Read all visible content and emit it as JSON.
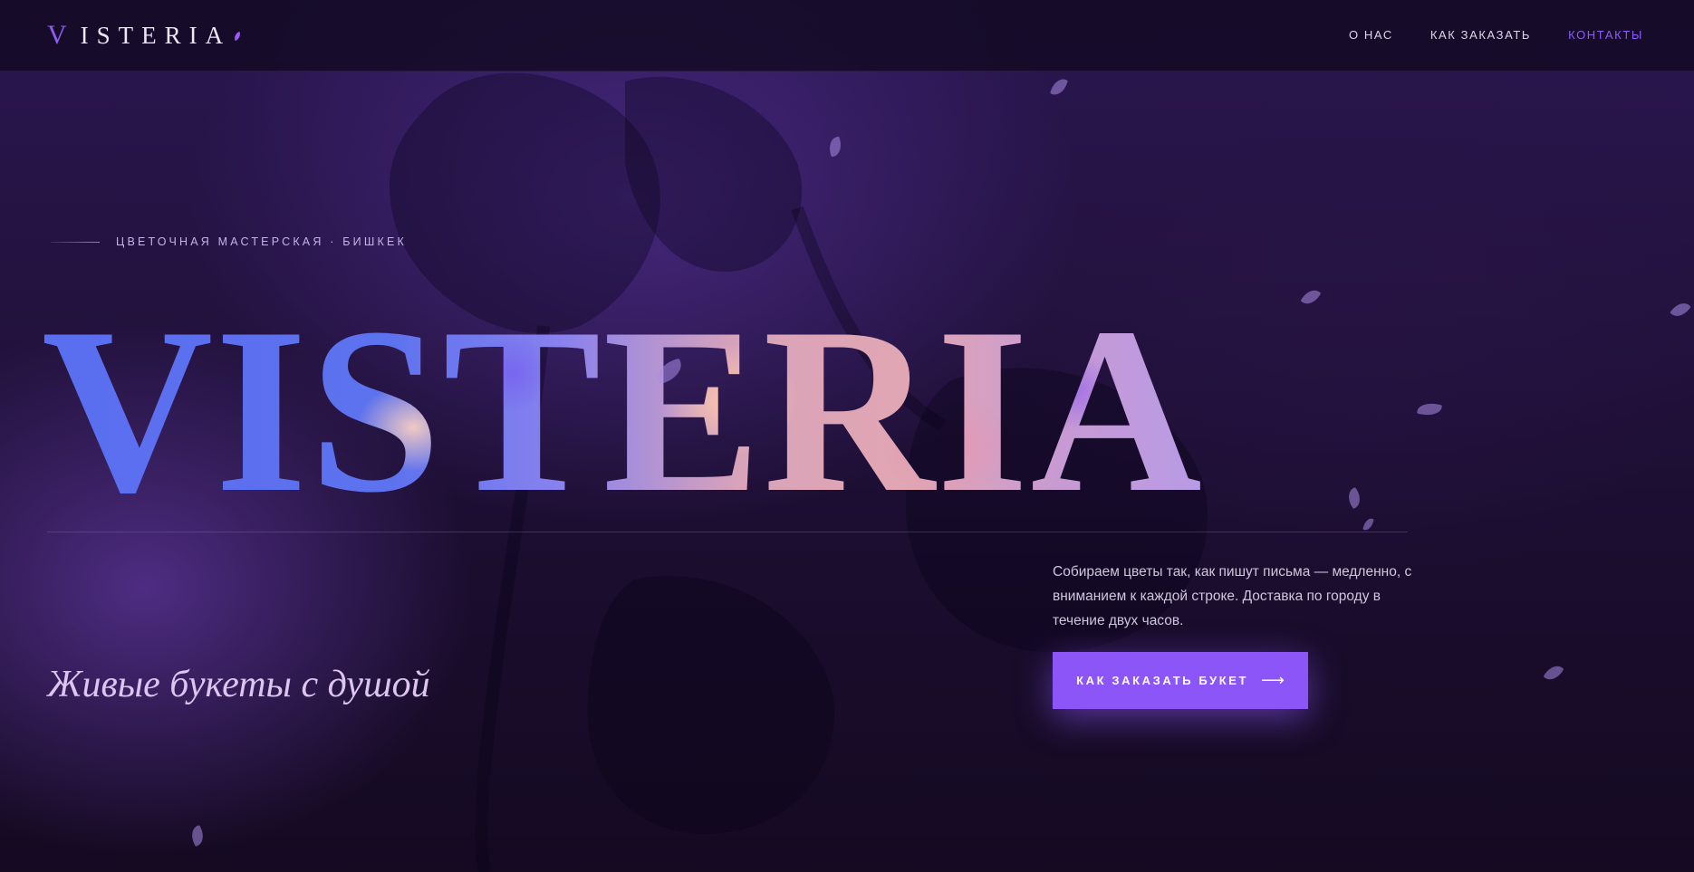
{
  "header": {
    "logo": {
      "initial": "V",
      "rest": "ISTERIA"
    },
    "nav": [
      {
        "label": "О НАС",
        "active": false
      },
      {
        "label": "КАК ЗАКАЗАТЬ",
        "active": false
      },
      {
        "label": "КОНТАКТЫ",
        "active": true
      }
    ]
  },
  "hero": {
    "eyebrow": "ЦВЕТОЧНАЯ МАСТЕРСКАЯ · БИШКЕК",
    "title": "VISTERIA",
    "tagline": "Живые букеты с душой",
    "description": "Собираем цветы так, как пишут письма — медленно, с вниманием к каждой строке. Доставка по городу в течение двух часов.",
    "cta_label": "КАК ЗАКАЗАТЬ БУКЕТ",
    "cta_icon": "arrow-right-icon"
  },
  "colors": {
    "accent": "#8b55f7",
    "background": "#1a0d2e",
    "nav_active": "#8b5cf6"
  }
}
